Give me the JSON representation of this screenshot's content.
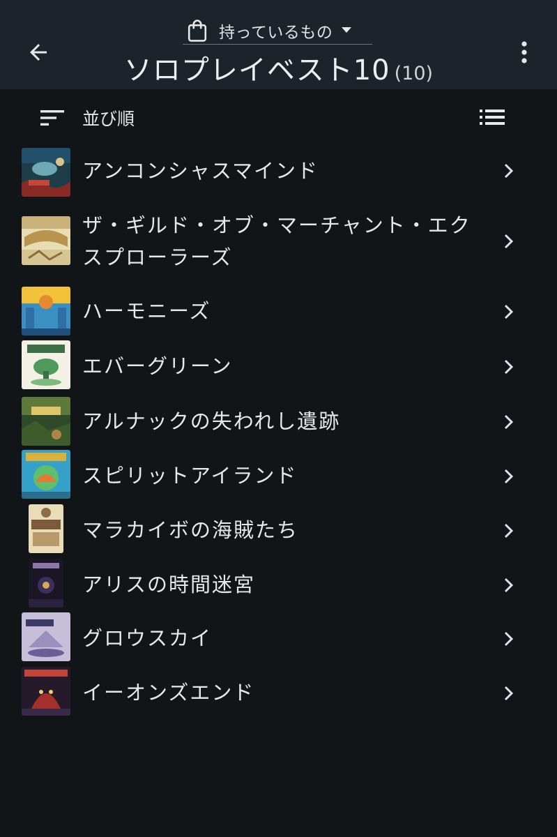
{
  "header": {
    "collection_label": "持っているもの",
    "title": "ソロプレイベスト10",
    "count": "(10)"
  },
  "toolbar": {
    "sort_label": "並び順"
  },
  "icons": {
    "back": "arrow-back-icon",
    "bag": "shopping-bag-icon",
    "caret": "dropdown-caret-icon",
    "more": "more-vert-icon",
    "sort": "sort-icon",
    "view": "list-view-icon",
    "chevron": "chevron-right-icon"
  },
  "colors": {
    "background": "#111518",
    "header": "#1c232b",
    "text": "#e6e9ec"
  },
  "games": [
    {
      "name": "アンコンシャスマインド"
    },
    {
      "name": "ザ・ギルド・オブ・マーチャント・エクスプローラーズ"
    },
    {
      "name": "ハーモニーズ"
    },
    {
      "name": "エバーグリーン"
    },
    {
      "name": "アルナックの失われし遺跡"
    },
    {
      "name": "スピリットアイランド"
    },
    {
      "name": "マラカイボの海賊たち"
    },
    {
      "name": "アリスの時間迷宮"
    },
    {
      "name": "グロウスカイ"
    },
    {
      "name": "イーオンズエンド"
    }
  ]
}
